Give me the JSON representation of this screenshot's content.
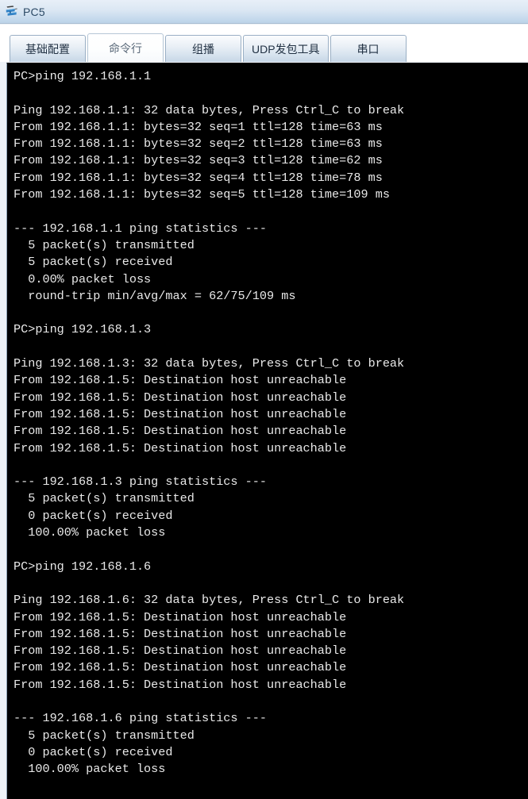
{
  "window": {
    "title": "PC5",
    "icon": "pc-device-icon"
  },
  "tabs": [
    {
      "id": "basic-config",
      "label": "基础配置",
      "active": false
    },
    {
      "id": "command-line",
      "label": "命令行",
      "active": true
    },
    {
      "id": "multicast",
      "label": "组播",
      "active": false
    },
    {
      "id": "udp-send-tool",
      "label": "UDP发包工具",
      "active": false
    },
    {
      "id": "serial-port",
      "label": "串口",
      "active": false
    }
  ],
  "colors": {
    "terminal_background": "#000000",
    "terminal_text": "#e9e9e9",
    "titlebar_top": "#e8eff8",
    "titlebar_bottom": "#bcd3e8",
    "tab_border": "#9aafc4"
  },
  "terminal": {
    "lines": [
      "PC>ping 192.168.1.1",
      "",
      "Ping 192.168.1.1: 32 data bytes, Press Ctrl_C to break",
      "From 192.168.1.1: bytes=32 seq=1 ttl=128 time=63 ms",
      "From 192.168.1.1: bytes=32 seq=2 ttl=128 time=63 ms",
      "From 192.168.1.1: bytes=32 seq=3 ttl=128 time=62 ms",
      "From 192.168.1.1: bytes=32 seq=4 ttl=128 time=78 ms",
      "From 192.168.1.1: bytes=32 seq=5 ttl=128 time=109 ms",
      "",
      "--- 192.168.1.1 ping statistics ---",
      "  5 packet(s) transmitted",
      "  5 packet(s) received",
      "  0.00% packet loss",
      "  round-trip min/avg/max = 62/75/109 ms",
      "",
      "PC>ping 192.168.1.3",
      "",
      "Ping 192.168.1.3: 32 data bytes, Press Ctrl_C to break",
      "From 192.168.1.5: Destination host unreachable",
      "From 192.168.1.5: Destination host unreachable",
      "From 192.168.1.5: Destination host unreachable",
      "From 192.168.1.5: Destination host unreachable",
      "From 192.168.1.5: Destination host unreachable",
      "",
      "--- 192.168.1.3 ping statistics ---",
      "  5 packet(s) transmitted",
      "  0 packet(s) received",
      "  100.00% packet loss",
      "",
      "PC>ping 192.168.1.6",
      "",
      "Ping 192.168.1.6: 32 data bytes, Press Ctrl_C to break",
      "From 192.168.1.5: Destination host unreachable",
      "From 192.168.1.5: Destination host unreachable",
      "From 192.168.1.5: Destination host unreachable",
      "From 192.168.1.5: Destination host unreachable",
      "From 192.168.1.5: Destination host unreachable",
      "",
      "--- 192.168.1.6 ping statistics ---",
      "  5 packet(s) transmitted",
      "  0 packet(s) received",
      "  100.00% packet loss",
      ""
    ]
  },
  "session_summary": {
    "ping_runs": [
      {
        "target": "192.168.1.1",
        "data_bytes": 32,
        "replies": [
          {
            "from": "192.168.1.1",
            "bytes": 32,
            "seq": 1,
            "ttl": 128,
            "time_ms": 63
          },
          {
            "from": "192.168.1.1",
            "bytes": 32,
            "seq": 2,
            "ttl": 128,
            "time_ms": 63
          },
          {
            "from": "192.168.1.1",
            "bytes": 32,
            "seq": 3,
            "ttl": 128,
            "time_ms": 62
          },
          {
            "from": "192.168.1.1",
            "bytes": 32,
            "seq": 4,
            "ttl": 128,
            "time_ms": 78
          },
          {
            "from": "192.168.1.1",
            "bytes": 32,
            "seq": 5,
            "ttl": 128,
            "time_ms": 109
          }
        ],
        "transmitted": 5,
        "received": 5,
        "packet_loss": "0.00%",
        "round_trip_min_avg_max_ms": "62/75/109"
      },
      {
        "target": "192.168.1.3",
        "data_bytes": 32,
        "replies": [
          {
            "from": "192.168.1.5",
            "message": "Destination host unreachable"
          },
          {
            "from": "192.168.1.5",
            "message": "Destination host unreachable"
          },
          {
            "from": "192.168.1.5",
            "message": "Destination host unreachable"
          },
          {
            "from": "192.168.1.5",
            "message": "Destination host unreachable"
          },
          {
            "from": "192.168.1.5",
            "message": "Destination host unreachable"
          }
        ],
        "transmitted": 5,
        "received": 0,
        "packet_loss": "100.00%"
      },
      {
        "target": "192.168.1.6",
        "data_bytes": 32,
        "replies": [
          {
            "from": "192.168.1.5",
            "message": "Destination host unreachable"
          },
          {
            "from": "192.168.1.5",
            "message": "Destination host unreachable"
          },
          {
            "from": "192.168.1.5",
            "message": "Destination host unreachable"
          },
          {
            "from": "192.168.1.5",
            "message": "Destination host unreachable"
          },
          {
            "from": "192.168.1.5",
            "message": "Destination host unreachable"
          }
        ],
        "transmitted": 5,
        "received": 0,
        "packet_loss": "100.00%"
      }
    ]
  }
}
